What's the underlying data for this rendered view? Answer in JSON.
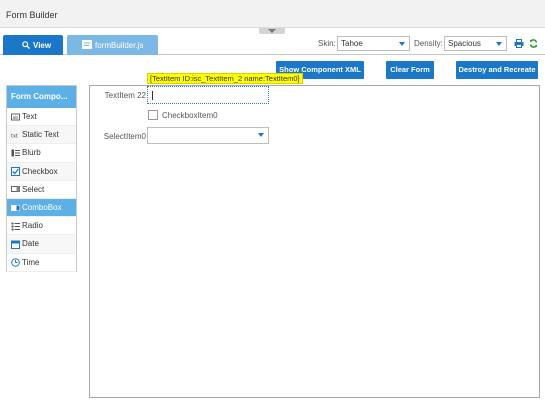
{
  "app": {
    "title": "Form Builder"
  },
  "tabs": [
    {
      "label": "View",
      "icon": "search-icon"
    },
    {
      "label": "formBuilder.js",
      "icon": "file-icon"
    }
  ],
  "toolbar": {
    "skin_label": "Skin:",
    "skin_value": "Tahoe",
    "density_label": "Density:",
    "density_value": "Spacious",
    "print_icon": "print-icon",
    "refresh_icon": "refresh-icon"
  },
  "actions": {
    "show_xml": "Show Component XML",
    "clear_form": "Clear Form",
    "destroy_recreate": "Destroy and Recreate"
  },
  "palette": {
    "header": "Form Compo...",
    "items": [
      {
        "label": "Text",
        "icon": "text-field-icon"
      },
      {
        "label": "Static Text",
        "icon": "static-text-icon"
      },
      {
        "label": "Blurb",
        "icon": "blurb-icon"
      },
      {
        "label": "Checkbox",
        "icon": "checkbox-icon"
      },
      {
        "label": "Select",
        "icon": "select-icon"
      },
      {
        "label": "ComboBox",
        "icon": "combobox-icon",
        "selected": true
      },
      {
        "label": "Radio",
        "icon": "radio-icon"
      },
      {
        "label": "Date",
        "icon": "date-icon"
      },
      {
        "label": "Time",
        "icon": "time-icon"
      }
    ]
  },
  "form": {
    "text_label": "TextItem 22",
    "text_value": "",
    "tooltip": "[TextItem ID:isc_TextItem_2 name:TextItem0]",
    "checkbox_label": "CheckboxItem0",
    "checkbox_checked": false,
    "select_label": "SelectItem0",
    "select_value": ""
  },
  "colors": {
    "accent": "#1b78c8",
    "tab_inactive": "#7bb8e6",
    "palette_header": "#5cb0e6",
    "tooltip_bg": "#ffff00"
  }
}
